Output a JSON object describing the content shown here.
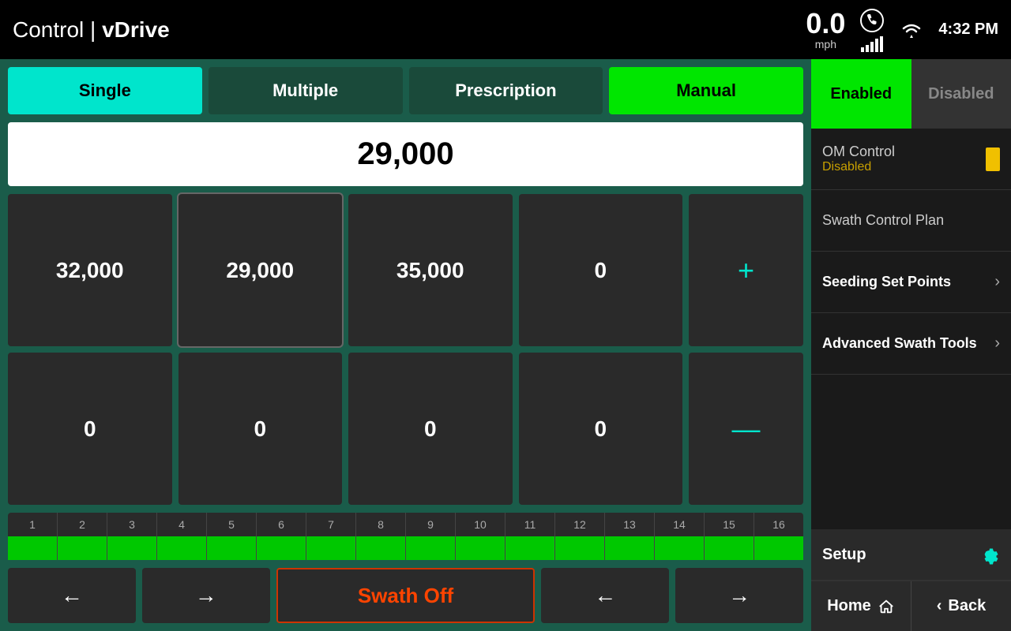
{
  "header": {
    "app_name": "Control",
    "separator": "|",
    "app_sub": "vDrive",
    "speed": "0.0",
    "speed_unit": "mph",
    "time": "4:32 PM"
  },
  "tabs": [
    {
      "id": "single",
      "label": "Single",
      "state": "active-cyan"
    },
    {
      "id": "multiple",
      "label": "Multiple",
      "state": "inactive"
    },
    {
      "id": "prescription",
      "label": "Prescription",
      "state": "inactive"
    },
    {
      "id": "manual",
      "label": "Manual",
      "state": "active-green"
    }
  ],
  "value_display": "29,000",
  "seed_columns": [
    {
      "top": "32,000",
      "bottom": "0"
    },
    {
      "top": "29,000",
      "bottom": "0"
    },
    {
      "top": "35,000",
      "bottom": "0"
    },
    {
      "top": "0",
      "bottom": "0"
    }
  ],
  "plus_symbol": "+",
  "minus_symbol": "—",
  "row_numbers": [
    1,
    2,
    3,
    4,
    5,
    6,
    7,
    8,
    9,
    10,
    11,
    12,
    13,
    14,
    15,
    16
  ],
  "row_states": [
    "green",
    "green",
    "green",
    "green",
    "green",
    "green",
    "green",
    "green",
    "green",
    "green",
    "green",
    "green",
    "green",
    "green",
    "green",
    "green"
  ],
  "bottom_controls": {
    "left_arrow_1": "←",
    "right_arrow_1": "→",
    "swath_btn": "Swath Off",
    "left_arrow_2": "←",
    "right_arrow_2": "→"
  },
  "right_panel": {
    "enabled_label": "Enabled",
    "disabled_label": "Disabled",
    "om_control_label": "OM Control",
    "om_control_status": "Disabled",
    "swath_control_plan_label": "Swath Control Plan",
    "seeding_set_points_label": "Seeding Set Points",
    "advanced_swath_tools_label": "Advanced Swath Tools",
    "setup_label": "Setup",
    "home_label": "Home",
    "back_label": "Back",
    "chevron_right": "›",
    "chevron_left": "‹"
  }
}
